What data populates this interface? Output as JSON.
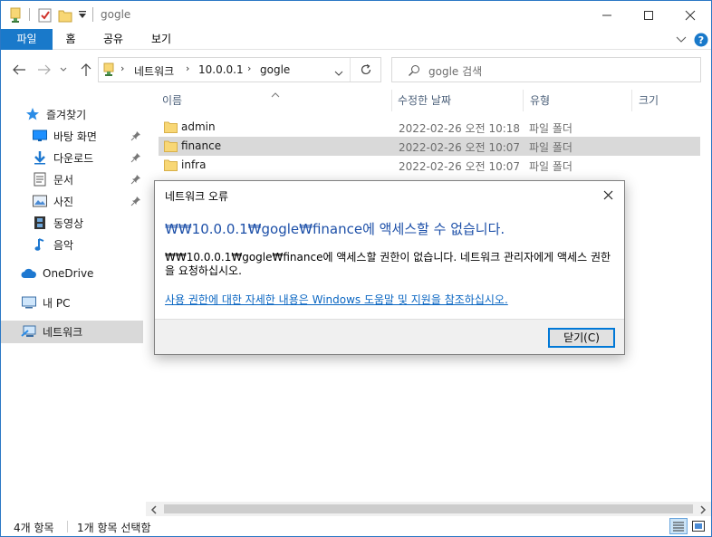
{
  "window": {
    "title": "gogle",
    "controls": [
      "minimize",
      "maximize",
      "close"
    ]
  },
  "ribbon": {
    "tabs": [
      "파일",
      "홈",
      "공유",
      "보기"
    ]
  },
  "address": {
    "crumbs": [
      "네트워크",
      "10.0.0.1",
      "gogle"
    ]
  },
  "search": {
    "placeholder": "gogle 검색"
  },
  "nav": {
    "quick_access": "즐겨찾기",
    "pinned": [
      "바탕 화면",
      "다운로드",
      "문서",
      "사진"
    ],
    "unpinned": [
      "동영상",
      "음악"
    ],
    "onedrive": "OneDrive",
    "thispc": "내 PC",
    "network": "네트워크"
  },
  "columns": {
    "name": "이름",
    "modified": "수정한 날짜",
    "type": "유형",
    "size": "크기"
  },
  "files": [
    {
      "name": "admin",
      "date": "2022-02-26 오전 10:18",
      "type": "파일 폴더",
      "selected": false
    },
    {
      "name": "finance",
      "date": "2022-02-26 오전 10:07",
      "type": "파일 폴더",
      "selected": true
    },
    {
      "name": "infra",
      "date": "2022-02-26 오전 10:07",
      "type": "파일 폴더",
      "selected": false
    }
  ],
  "status": {
    "count": "4개 항목",
    "selected": "1개 항목 선택함"
  },
  "dialog": {
    "title": "네트워크 오류",
    "main": "₩₩10.0.0.1₩gogle₩finance에 액세스할 수 없습니다.",
    "body": "₩₩10.0.0.1₩gogle₩finance에 액세스할 권한이 없습니다. 네트워크 관리자에게 액세스 권한을 요청하십시오.",
    "link": "사용 권한에 대한 자세한 내용은 Windows 도움말 및 지원을 참조하십시오.",
    "close_button": "닫기(C)"
  },
  "colors": {
    "accent": "#1979ca",
    "dialog_heading": "#1c4fa8",
    "link": "#0a66c2",
    "selection": "#d9d9d9",
    "folder": "#f8d775"
  }
}
